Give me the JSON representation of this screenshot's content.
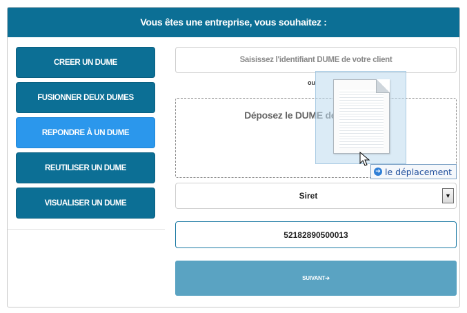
{
  "header": {
    "title": "Vous êtes une entreprise, vous souhaitez :"
  },
  "nav": [
    {
      "label": "CREER UN DUME",
      "active": false
    },
    {
      "label": "FUSIONNER DEUX DUMES",
      "active": false
    },
    {
      "label": "REPONDRE À UN DUME",
      "active": true
    },
    {
      "label": "REUTILISER UN DUME",
      "active": false
    },
    {
      "label": "VISUALISER UN DUME",
      "active": false
    }
  ],
  "form": {
    "dume_id_placeholder": "Saisissez l'identifiant DUME de votre client",
    "or_label": "ou",
    "dropzone_text": "Déposez le DUME de votre client",
    "identifier_type": "Siret",
    "identifier_value": "52182890500013",
    "next_label": "SUIVANT",
    "next_arrow": "➔"
  },
  "drag": {
    "tooltip_text": "le déplacement",
    "tooltip_icon": "arrow-right-icon",
    "ghost_icon": "document-icon"
  },
  "colors": {
    "primary": "#0c6f95",
    "active": "#2b97ec",
    "next_button": "#5aa3c2"
  }
}
